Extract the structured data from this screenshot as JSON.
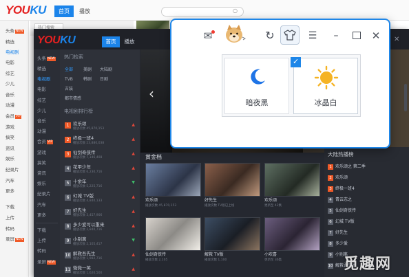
{
  "light_window": {
    "logo_you": "YOU",
    "logo_ku": "KU",
    "tabs": {
      "active": "首页",
      "idle": "播放"
    },
    "search_placeholder": "热门搜索",
    "sidebar": [
      {
        "label": "头条",
        "badge": "NEW"
      },
      {
        "label": "精选"
      },
      {
        "label": "电视剧",
        "active": true
      },
      {
        "label": "电影"
      },
      {
        "label": "综艺"
      },
      {
        "label": "少儿"
      },
      {
        "label": "音乐"
      },
      {
        "label": "动漫"
      },
      {
        "label": "会员",
        "badge": "VIP"
      },
      {
        "label": "游戏"
      },
      {
        "label": "搞笑"
      },
      {
        "label": "资讯"
      },
      {
        "label": "娱乐"
      },
      {
        "label": "纪录片"
      },
      {
        "label": "汽车"
      },
      {
        "label": "更多"
      },
      {
        "label": "下载"
      },
      {
        "label": "上传"
      },
      {
        "label": "转码"
      },
      {
        "label": "录屏",
        "badge": "NEW"
      }
    ]
  },
  "dark_window": {
    "logo_you": "YOU",
    "logo_ku": "KU",
    "tabs": {
      "active": "首页",
      "idle": "播放"
    },
    "close_glyph": "✕",
    "sidebar": [
      {
        "label": "头条",
        "badge": "NEW"
      },
      {
        "label": "精选"
      },
      {
        "label": "电视剧",
        "active": true
      },
      {
        "label": "电影"
      },
      {
        "label": "综艺"
      },
      {
        "label": "少儿"
      },
      {
        "label": "音乐"
      },
      {
        "label": "动漫"
      },
      {
        "label": "会员",
        "badge": "VIP"
      },
      {
        "label": "游戏"
      },
      {
        "label": "搞笑"
      },
      {
        "label": "资讯"
      },
      {
        "label": "娱乐"
      },
      {
        "label": "纪录片"
      },
      {
        "label": "汽车"
      },
      {
        "label": "更多"
      },
      {
        "label": "下载"
      },
      {
        "label": "上传"
      },
      {
        "label": "转码"
      },
      {
        "label": "录屏",
        "badge": "NEW"
      }
    ],
    "panel": {
      "hot_search_title": "热门检索",
      "tags_row1": [
        "全部",
        "美剧",
        "大陆剧"
      ],
      "tags_row2": [
        "TVB",
        "韩剧",
        "日剧"
      ],
      "tag_row3": "古装",
      "tag_row4": "都市情感",
      "ranking_title": "电视剧排行榜",
      "rankings": [
        {
          "num": "1",
          "title": "欢乐颂",
          "sub": "播放次数 45,870,153",
          "trend": "up"
        },
        {
          "num": "2",
          "title": "终极一班4",
          "sub": "播放次数 23,880,038",
          "trend": "up"
        },
        {
          "num": "3",
          "title": "仙剑奇侠传",
          "sub": "播放次数 7,146,408",
          "trend": "up"
        },
        {
          "num": "4",
          "title": "花甲少年",
          "sub": "播放次数 6,230,716",
          "trend": "up"
        },
        {
          "num": "5",
          "title": "十余年",
          "sub": "播放次数 5,225,716",
          "trend": "down"
        },
        {
          "num": "6",
          "title": "幻城 TV版",
          "sub": "播放次数 4,840,133",
          "trend": "up"
        },
        {
          "num": "7",
          "title": "好先生",
          "sub": "播放次数 3,457,906",
          "trend": "up"
        },
        {
          "num": "8",
          "title": "多少爱可以重来",
          "sub": "播放次数 2,840,716",
          "trend": "up"
        },
        {
          "num": "9",
          "title": "小别离",
          "sub": "播放次数 2,105,417",
          "trend": "down"
        },
        {
          "num": "10",
          "title": "解救吾先生",
          "sub": "播放次数 1,982,716",
          "trend": "up"
        },
        {
          "num": "11",
          "title": "微微一笑",
          "sub": "播放次数 1,620,500",
          "trend": "up"
        }
      ]
    },
    "banner_arrow": "‹",
    "gold": {
      "title": "黄金档",
      "items": [
        {
          "title": "欢乐颂",
          "sub": "播放次数 45,870,153"
        },
        {
          "title": "好先生",
          "sub": "播放次数 TV版已上线"
        },
        {
          "title": "欢乐颂",
          "sub": "更新至 42集"
        },
        {
          "title": "仙剑奇侠传",
          "sub": "播放次数 2,105"
        },
        {
          "title": "解救 TV版",
          "sub": "播放次数 1,100"
        },
        {
          "title": "小欢喜",
          "sub": "更新至 36集"
        }
      ]
    },
    "right_list": {
      "title": "大陆热播榜",
      "items": [
        {
          "num": "1",
          "title": "欢乐颂之 第二季"
        },
        {
          "num": "2",
          "title": "欢乐颂"
        },
        {
          "num": "3",
          "title": "终极一班4"
        },
        {
          "num": "4",
          "title": "青云志之"
        },
        {
          "num": "5",
          "title": "仙剑奇侠传"
        },
        {
          "num": "6",
          "title": "幻城 TV版"
        },
        {
          "num": "7",
          "title": "好先生"
        },
        {
          "num": "8",
          "title": "多少爱"
        },
        {
          "num": "9",
          "title": "小别离"
        },
        {
          "num": "10",
          "title": "解救吾先生"
        }
      ]
    }
  },
  "popup": {
    "icons": {
      "mail": "✉",
      "refresh": "↻",
      "skin": "👕",
      "menu": "☰",
      "minimize": "–",
      "close": "✕"
    },
    "themes": [
      {
        "name": "暗夜黑",
        "icon": "moon-icon"
      },
      {
        "name": "冰晶白",
        "icon": "sun-icon",
        "selected": true
      }
    ],
    "check_glyph": "✓"
  },
  "watermark": "觅趣网",
  "colors": {
    "accent_blue": "#1b84ea",
    "logo_red": "#e42121",
    "dark_bg": "#252830",
    "hot_orange": "#f05a28",
    "sun_yellow": "#f5b324",
    "moon_blue": "#1f74e6"
  }
}
